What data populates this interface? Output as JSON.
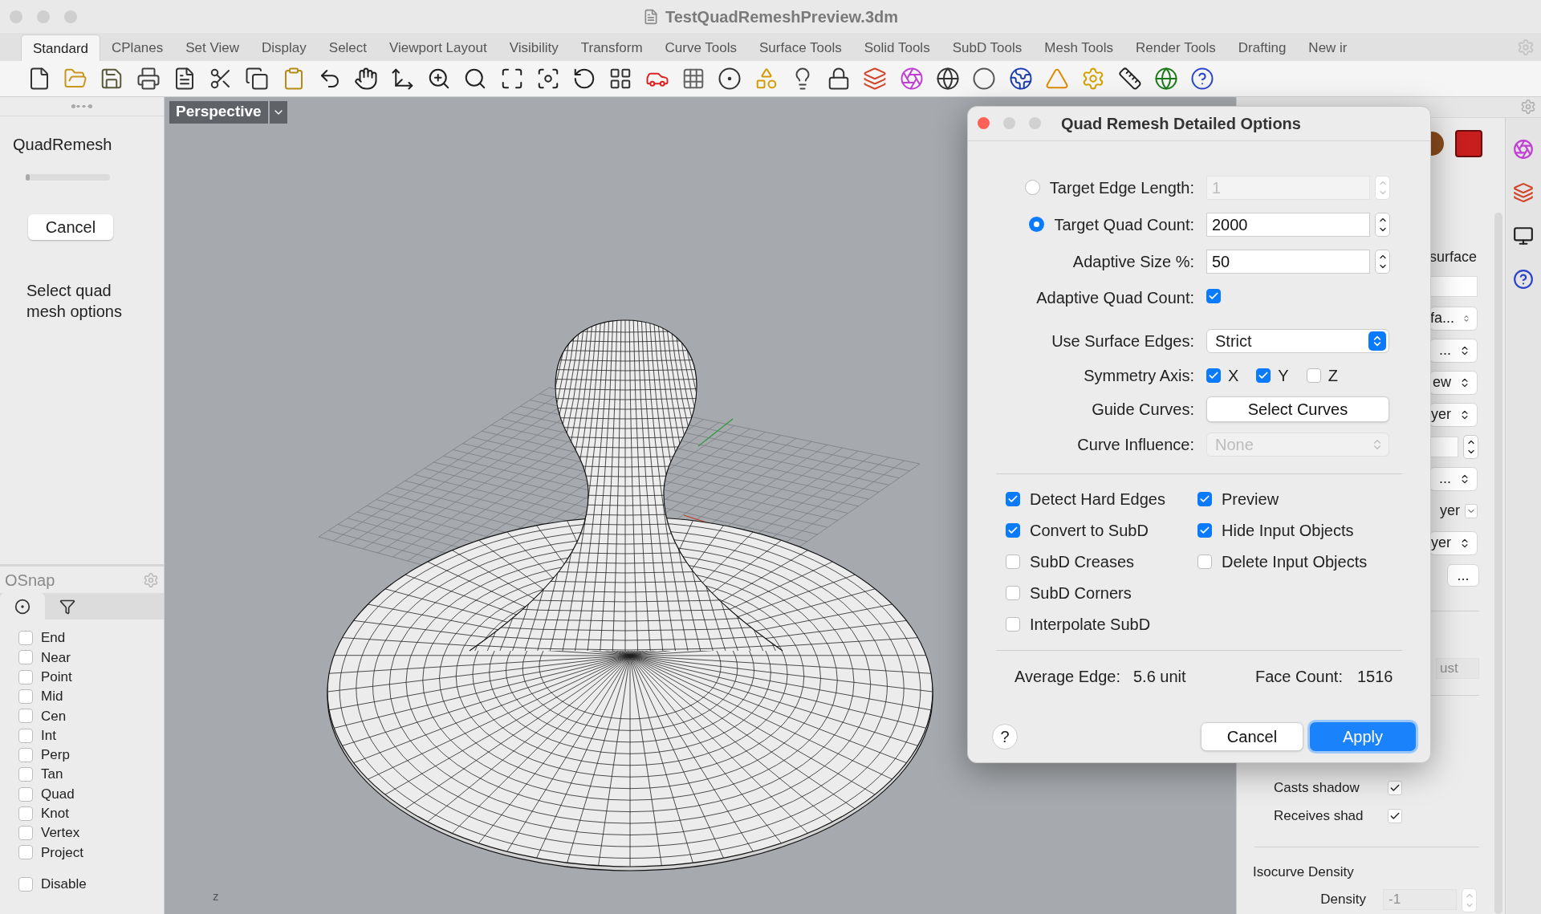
{
  "window": {
    "title": "TestQuadRemeshPreview.3dm"
  },
  "toolbar_tabs": [
    {
      "label": "Standard",
      "selected": true
    },
    {
      "label": "CPlanes",
      "selected": false
    },
    {
      "label": "Set View",
      "selected": false
    },
    {
      "label": "Display",
      "selected": false
    },
    {
      "label": "Select",
      "selected": false
    },
    {
      "label": "Viewport Layout",
      "selected": false
    },
    {
      "label": "Visibility",
      "selected": false
    },
    {
      "label": "Transform",
      "selected": false
    },
    {
      "label": "Curve Tools",
      "selected": false
    },
    {
      "label": "Surface Tools",
      "selected": false
    },
    {
      "label": "Solid Tools",
      "selected": false
    },
    {
      "label": "SubD Tools",
      "selected": false
    },
    {
      "label": "Mesh Tools",
      "selected": false
    },
    {
      "label": "Render Tools",
      "selected": false
    },
    {
      "label": "Drafting",
      "selected": false
    },
    {
      "label": "New ir",
      "selected": false
    }
  ],
  "command_panel": {
    "title": "QuadRemesh",
    "progress": {
      "level": 0.05
    },
    "cancel_button": "Cancel",
    "prompt": "Select quad mesh options"
  },
  "osnap": {
    "title": "OSnap",
    "tabs": [
      {
        "kind": "osnap",
        "selected": true
      },
      {
        "kind": "filter",
        "selected": false
      }
    ],
    "items": [
      {
        "label": "End",
        "checked": false
      },
      {
        "label": "Near",
        "checked": false
      },
      {
        "label": "Point",
        "checked": false
      },
      {
        "label": "Mid",
        "checked": false
      },
      {
        "label": "Cen",
        "checked": false
      },
      {
        "label": "Int",
        "checked": false
      },
      {
        "label": "Perp",
        "checked": false
      },
      {
        "label": "Tan",
        "checked": false
      },
      {
        "label": "Quad",
        "checked": false
      },
      {
        "label": "Knot",
        "checked": false
      },
      {
        "label": "Vertex",
        "checked": false
      },
      {
        "label": "Project",
        "checked": false
      }
    ],
    "disable": {
      "label": "Disable",
      "checked": false
    }
  },
  "viewport": {
    "title": "Perspective",
    "axis_label": "z"
  },
  "dialog": {
    "title": "Quad Remesh Detailed Options",
    "target_modes": [
      {
        "label": "Target Edge Length:",
        "value": "1",
        "selected": false
      },
      {
        "label": "Target Quad Count:",
        "value": "2000",
        "selected": true
      }
    ],
    "adaptive_size": {
      "label": "Adaptive Size %:",
      "value": "50"
    },
    "adaptive_quad_count": {
      "label": "Adaptive Quad Count:",
      "checked": true
    },
    "use_surface_edges": {
      "label": "Use Surface Edges:",
      "value": "Strict"
    },
    "symmetry_axis": {
      "label": "Symmetry Axis:",
      "axes": [
        {
          "label": "X",
          "checked": true
        },
        {
          "label": "Y",
          "checked": true
        },
        {
          "label": "Z",
          "checked": false
        }
      ]
    },
    "guide_curves": {
      "label": "Guide Curves:",
      "button": "Select Curves"
    },
    "curve_influence": {
      "label": "Curve Influence:",
      "value": "None",
      "disabled": true
    },
    "options_left": [
      {
        "label": "Detect Hard Edges",
        "checked": true
      },
      {
        "label": "Convert to SubD",
        "checked": true
      },
      {
        "label": "SubD Creases",
        "checked": false
      },
      {
        "label": "SubD Corners",
        "checked": false
      },
      {
        "label": "Interpolate SubD",
        "checked": false
      }
    ],
    "options_right": [
      {
        "label": "Preview",
        "checked": true
      },
      {
        "label": "Hide Input Objects",
        "checked": true
      },
      {
        "label": "Delete Input Objects",
        "checked": false
      }
    ],
    "average_edge": {
      "label": "Average Edge:",
      "value": "5.6 unit"
    },
    "face_count": {
      "label": "Face Count:",
      "value": "1516"
    },
    "help_button": "?",
    "buttons": [
      {
        "label": "Cancel",
        "kind": "secondary"
      },
      {
        "label": "Apply",
        "kind": "default"
      }
    ]
  },
  "properties_panel": {
    "rows": [
      {
        "kind": "label",
        "text": "surface"
      },
      {
        "kind": "field"
      },
      {
        "kind": "select",
        "text": "fa..."
      },
      {
        "kind": "select",
        "text": "..."
      },
      {
        "kind": "select",
        "text": "ew"
      },
      {
        "kind": "select",
        "text": "yer"
      },
      {
        "kind": "stepper"
      },
      {
        "kind": "select",
        "text": "..."
      },
      {
        "kind": "dropdown",
        "text": "yer"
      },
      {
        "kind": "select",
        "text": "yer"
      },
      {
        "kind": "button",
        "text": "..."
      }
    ],
    "disabled_field": "ust",
    "shadows": [
      {
        "label": "Casts shadow",
        "checked": true
      },
      {
        "label": "Receives shad",
        "checked": true
      }
    ],
    "isocurve": {
      "title": "Isocurve Density",
      "label": "Density",
      "value": "-1"
    }
  }
}
